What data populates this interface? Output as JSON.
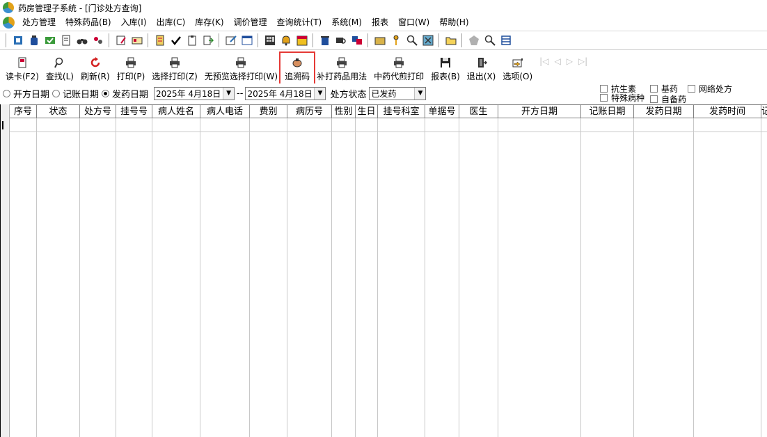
{
  "window": {
    "title": "药房管理子系统 - [门诊处方查询]"
  },
  "menubar": {
    "items": [
      "处方管理",
      "特殊药品(B)",
      "入库(I)",
      "出库(C)",
      "库存(K)",
      "调价管理",
      "查询统计(T)",
      "系统(M)",
      "报表",
      "窗口(W)",
      "帮助(H)"
    ]
  },
  "toolbar_buttons": [
    {
      "label": "读卡(F2)",
      "icon": "card-reader-icon"
    },
    {
      "label": "查找(L)",
      "icon": "magnifier-icon"
    },
    {
      "label": "刷新(R)",
      "icon": "refresh-icon"
    },
    {
      "label": "打印(P)",
      "icon": "printer-icon"
    },
    {
      "label": "选择打印(Z)",
      "icon": "printer-icon"
    },
    {
      "label": "无预览选择打印(W)",
      "icon": "printer-icon"
    },
    {
      "label": "追溯码",
      "icon": "trace-code-icon"
    },
    {
      "label": "补打药品用法",
      "icon": "printer-icon"
    },
    {
      "label": "中药代煎打印",
      "icon": "printer-icon"
    },
    {
      "label": "报表(B)",
      "icon": "floppy-icon"
    },
    {
      "label": "退出(X)",
      "icon": "exit-door-icon"
    },
    {
      "label": "选项(O)",
      "icon": "options-icon"
    }
  ],
  "filter": {
    "radios": [
      {
        "label": "开方日期",
        "selected": false
      },
      {
        "label": "记账日期",
        "selected": false
      },
      {
        "label": "发药日期",
        "selected": true
      }
    ],
    "date_from": "2025年 4月18日",
    "separator": "--",
    "date_to": "2025年 4月18日",
    "status_label": "处方状态",
    "status_value": "已发药",
    "checkboxes": {
      "antibiotic": "抗生素",
      "essential": "基药",
      "online_rx": "网络处方",
      "special_disease": "特殊病种",
      "self_prepared": "自备药"
    }
  },
  "table": {
    "columns": [
      "序号",
      "状态",
      "处方号",
      "挂号号",
      "病人姓名",
      "病人电话",
      "费别",
      "病历号",
      "性别",
      "生日",
      "挂号科室",
      "单据号",
      "医生",
      "开方日期",
      "记账日期",
      "发药日期",
      "发药时间",
      "记"
    ]
  },
  "colors": {
    "highlight_border": "#e53935"
  }
}
